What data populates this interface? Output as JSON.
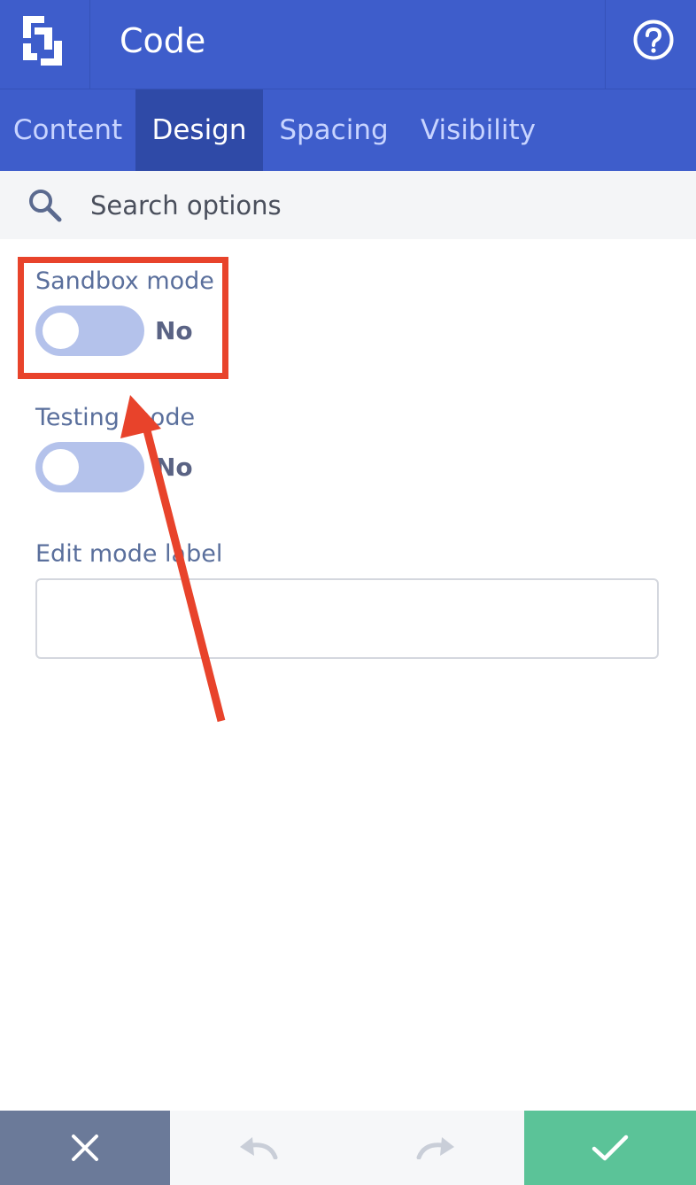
{
  "header": {
    "title": "Code",
    "logo_icon": "builder-logo-icon",
    "help_icon": "help-circle-icon"
  },
  "tabs": [
    {
      "label": "Content",
      "active": false
    },
    {
      "label": "Design",
      "active": true
    },
    {
      "label": "Spacing",
      "active": false
    },
    {
      "label": "Visibility",
      "active": false
    }
  ],
  "search": {
    "placeholder": "Search options",
    "icon": "search-icon"
  },
  "fields": {
    "sandbox_mode": {
      "label": "Sandbox mode",
      "value": "No",
      "on": false
    },
    "testing_mode": {
      "label": "Testing mode",
      "value": "No",
      "on": false
    },
    "edit_mode_label": {
      "label": "Edit mode label",
      "value": ""
    }
  },
  "footer": {
    "cancel_icon": "close-icon",
    "undo_icon": "undo-icon",
    "redo_icon": "redo-icon",
    "save_icon": "check-icon"
  },
  "colors": {
    "header_bg": "#3e5dcb",
    "active_tab_bg": "#2f4aa7",
    "annotation": "#e8432b",
    "save_button": "#5bc398",
    "cancel_button": "#6b7a99"
  }
}
